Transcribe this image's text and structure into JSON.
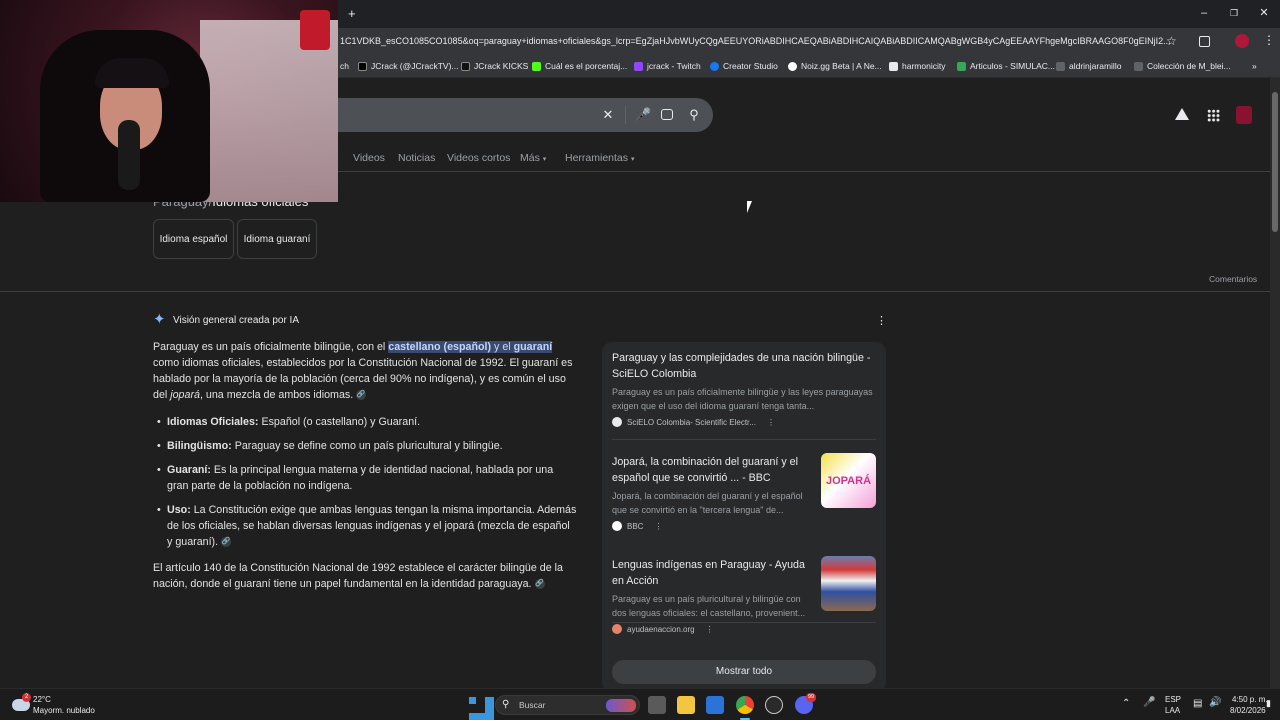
{
  "browser": {
    "new_tab": "+",
    "url": "1C1VDKB_esCO1085CO1085&oq=paraguay+idiomas+oficiales&gs_lcrp=EgZjaHJvbWUyCQgAEEUYORiABDIHCAEQABiABDIHCAIQABiABDIICAMQABgWGB4yCAgEEAAYFhgeMgcIBRAAGO8F0gEINjI2...",
    "bookmarks": [
      {
        "label": "ch",
        "color": "#888888"
      },
      {
        "label": "JCrack (@JCrackTV)...",
        "color": "#000000"
      },
      {
        "label": "JCrack KICKS",
        "color": "#000000"
      },
      {
        "label": "Cuál es el porcentaj...",
        "color": "#53fc18"
      },
      {
        "label": "jcrack - Twitch",
        "color": "#9146ff"
      },
      {
        "label": "Creator Studio",
        "color": "#1877f2"
      },
      {
        "label": "Noiz.gg Beta | A Ne...",
        "color": "#ffffff"
      },
      {
        "label": "harmonicity",
        "color": "#e8eaed"
      },
      {
        "label": "Articulos - SIMULAC...",
        "color": "#34a853"
      },
      {
        "label": "aldrinjaramillo",
        "color": "#5f6368"
      },
      {
        "label": "Colección de M_blei...",
        "color": "#5f6368"
      }
    ]
  },
  "search": {
    "tabs": [
      "Videos",
      "Noticias",
      "Videos cortos",
      "Más",
      "Herramientas"
    ],
    "breadcrumb_prefix": "Paraguay",
    "breadcrumb_current": "Idiomas oficiales",
    "chips": [
      "Idioma español",
      "Idioma guaraní"
    ],
    "feedback": "Comentarios"
  },
  "ai_overview": {
    "header": "Visión general creada por IA",
    "intro_pre": "Paraguay es un país oficialmente bilingüe, con el ",
    "intro_hl1": "castellano (español)",
    "intro_mid": " y el ",
    "intro_hl2": "guaraní",
    "intro_post": " como idiomas oficiales, establecidos por la Constitución Nacional de 1992. El guaraní es hablado por la mayoría de la población (cerca del 90% no indígena), y es común el uso del ",
    "intro_italic": "jopará",
    "intro_end": ", una mezcla de ambos idiomas.",
    "bullets": [
      {
        "bold": "Idiomas Oficiales:",
        "text": " Español (o castellano) y Guaraní."
      },
      {
        "bold": "Bilingüismo:",
        "text": " Paraguay se define como un país pluricultural y bilingüe."
      },
      {
        "bold": "Guaraní:",
        "text": " Es la principal lengua materna y de identidad nacional, hablada por una gran parte de la población no indígena."
      },
      {
        "bold": "Uso:",
        "text": " La Constitución exige que ambas lenguas tengan la misma importancia. Además de los oficiales, se hablan diversas lenguas indígenas y el jopará (mezcla de español y guaraní)."
      }
    ],
    "closing": "El artículo 140 de la Constitución Nacional de 1992 establece el carácter bilingüe de la nación, donde el guaraní tiene un papel fundamental en la identidad paraguaya."
  },
  "sources": [
    {
      "title": "Paraguay y las complejidades de una nación bilingüe - SciELO Colombia",
      "snippet": "Paraguay es un país oficialmente bilingüe y las leyes paraguayas exigen que el uso del idioma guaraní tenga tanta...",
      "site": "SciELO Colombia- Scientific Electr...",
      "favicon_color": "#e8eaed"
    },
    {
      "title": "Jopará, la combinación del guaraní y el español que se convirtió ... - BBC",
      "snippet": "Jopará, la combinación del guaraní y el español que se convirtió en la \"tercera lengua\" de...",
      "site": "BBC",
      "favicon_color": "#ffffff",
      "thumb_text": "JOPARÁ"
    },
    {
      "title": "Lenguas indígenas en Paraguay - Ayuda en Acción",
      "snippet": "Paraguay es un país pluricultural y bilingüe con dos lenguas oficiales: el castellano, provenient...",
      "site": "ayudaenaccion.org",
      "favicon_color": "#e8836b"
    }
  ],
  "show_all": "Mostrar todo",
  "taskbar": {
    "weather_temp": "22°C",
    "weather_desc": "Mayorm. nublado",
    "weather_badge": "2",
    "search_placeholder": "Buscar",
    "lang_top": "ESP",
    "lang_bottom": "LAA",
    "time": "4:50 p. m.",
    "date": "8/02/2026",
    "discord_badge": "99"
  }
}
